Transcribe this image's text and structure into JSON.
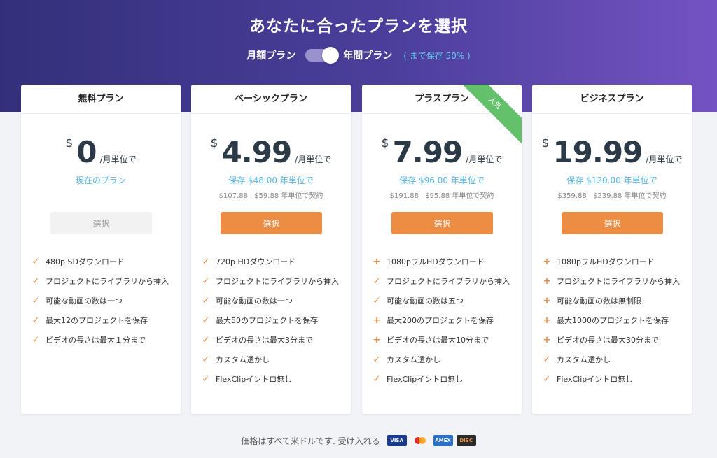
{
  "header": {
    "title": "あなたに合ったプランを選択",
    "monthly_label": "月額プラン",
    "yearly_label": "年間プラン",
    "save_note": "( まで保存 50% )"
  },
  "colors": {
    "accent": "#ed8c43",
    "link": "#58b7e6",
    "ribbon": "#62c16a",
    "hero_start": "#33307a",
    "hero_end": "#7353c2"
  },
  "plans": [
    {
      "name": "無料プラン",
      "currency": "$",
      "price": "0",
      "per": "/月単位で",
      "note": "現在のプラン",
      "old_price": "",
      "yearly": "",
      "button": "選択",
      "features": [
        {
          "icon": "check-icon",
          "text": "480p SDダウンロード"
        },
        {
          "icon": "check-icon",
          "text": "プロジェクトにライブラリから挿入"
        },
        {
          "icon": "check-icon",
          "text": "可能な動画の数は一つ"
        },
        {
          "icon": "check-icon",
          "text": "最大12のプロジェクトを保存"
        },
        {
          "icon": "check-icon",
          "text": "ビデオの長さは最大１分まで"
        }
      ]
    },
    {
      "name": "ベーシックプラン",
      "currency": "$",
      "price": "4.99",
      "per": "/月単位で",
      "note": "保存 $48.00 年単位で",
      "old_price": "$107.88",
      "yearly": "$59.88 年単位で契約",
      "button": "選択",
      "features": [
        {
          "icon": "check-icon",
          "text": "720p HDダウンロード"
        },
        {
          "icon": "check-icon",
          "text": "プロジェクトにライブラリから挿入"
        },
        {
          "icon": "check-icon",
          "text": "可能な動画の数は一つ"
        },
        {
          "icon": "check-icon",
          "text": "最大50のプロジェクトを保存"
        },
        {
          "icon": "check-icon",
          "text": "ビデオの長さは最大3分まで"
        },
        {
          "icon": "check-icon",
          "text": "カスタム透かし"
        },
        {
          "icon": "check-icon",
          "text": "FlexClipイントロ無し"
        }
      ]
    },
    {
      "name": "プラスプラン",
      "ribbon": "人気",
      "currency": "$",
      "price": "7.99",
      "per": "/月単位で",
      "note": "保存 $96.00 年単位で",
      "old_price": "$191.88",
      "yearly": "$95.88 年単位で契約",
      "button": "選択",
      "features": [
        {
          "icon": "plus-icon",
          "text": "1080pフルHDダウンロード"
        },
        {
          "icon": "check-icon",
          "text": "プロジェクトにライブラリから挿入"
        },
        {
          "icon": "check-icon",
          "text": "可能な動画の数は五つ"
        },
        {
          "icon": "plus-icon",
          "text": "最大200のプロジェクトを保存"
        },
        {
          "icon": "plus-icon",
          "text": "ビデオの長さは最大10分まで"
        },
        {
          "icon": "check-icon",
          "text": "カスタム透かし"
        },
        {
          "icon": "check-icon",
          "text": "FlexClipイントロ無し"
        }
      ]
    },
    {
      "name": "ビジネスプラン",
      "currency": "$",
      "price": "19.99",
      "per": "/月単位で",
      "note": "保存 $120.00 年単位で",
      "old_price": "$359.88",
      "yearly": "$239.88 年単位で契約",
      "button": "選択",
      "features": [
        {
          "icon": "plus-icon",
          "text": "1080pフルHDダウンロード"
        },
        {
          "icon": "plus-icon",
          "text": "プロジェクトにライブラリから挿入"
        },
        {
          "icon": "plus-icon",
          "text": "可能な動画の数は無制限"
        },
        {
          "icon": "plus-icon",
          "text": "最大1000のプロジェクトを保存"
        },
        {
          "icon": "plus-icon",
          "text": "ビデオの長さは最大30分まで"
        },
        {
          "icon": "check-icon",
          "text": "カスタム透かし"
        },
        {
          "icon": "check-icon",
          "text": "FlexClipイントロ無し"
        }
      ]
    }
  ],
  "footer": {
    "text": "価格はすべて米ドルです. 受け入れる",
    "payment_icons": [
      "visa-icon",
      "mastercard-icon",
      "amex-icon",
      "discover-icon"
    ],
    "visa_label": "VISA",
    "amex_label": "AMEX",
    "discover_label": "DISC"
  }
}
